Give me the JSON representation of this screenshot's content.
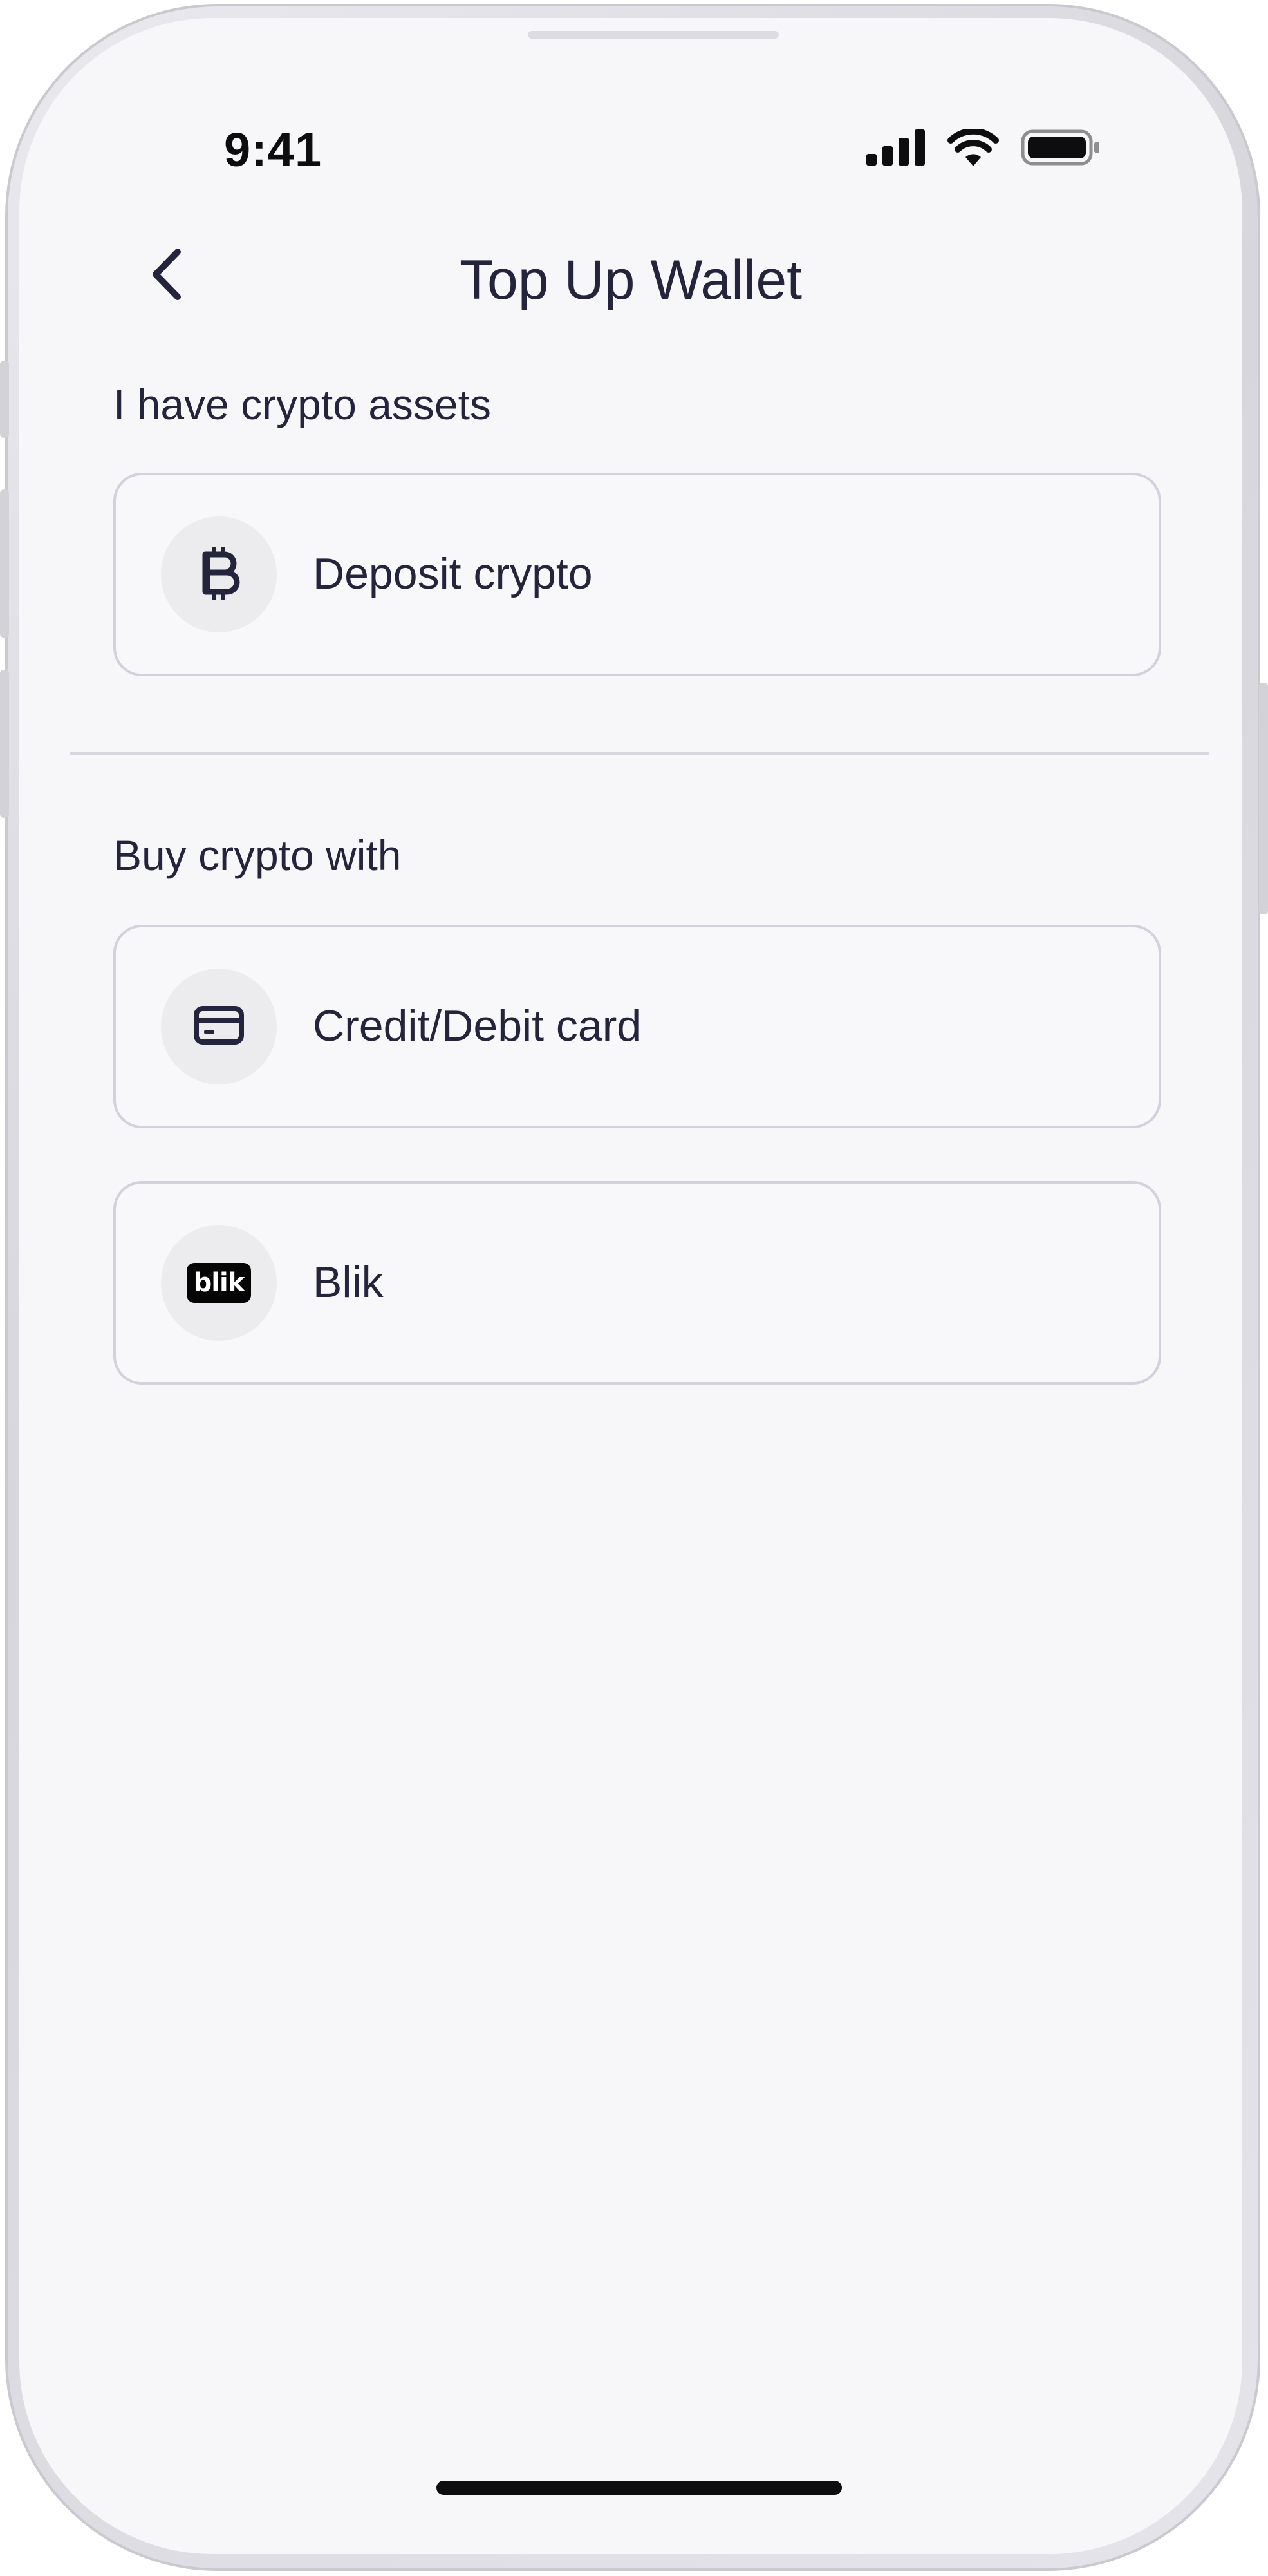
{
  "status_bar": {
    "time": "9:41",
    "icons": [
      "cellular-signal-icon",
      "wifi-icon",
      "battery-icon"
    ]
  },
  "nav": {
    "title": "Top Up Wallet",
    "back_icon": "chevron-left-icon"
  },
  "sections": [
    {
      "label": "I have crypto assets",
      "options": [
        {
          "label": "Deposit crypto",
          "icon": "bitcoin-icon"
        }
      ]
    },
    {
      "label": "Buy crypto with",
      "options": [
        {
          "label": "Credit/Debit card",
          "icon": "credit-card-icon"
        },
        {
          "label": "Blik",
          "icon": "blik-logo-icon",
          "logo_text": "blik"
        }
      ]
    }
  ],
  "colors": {
    "text_primary": "#25243d",
    "card_border": "#d2d1dc",
    "icon_bg": "#ececee",
    "screen_bg": "#f7f7f9"
  }
}
